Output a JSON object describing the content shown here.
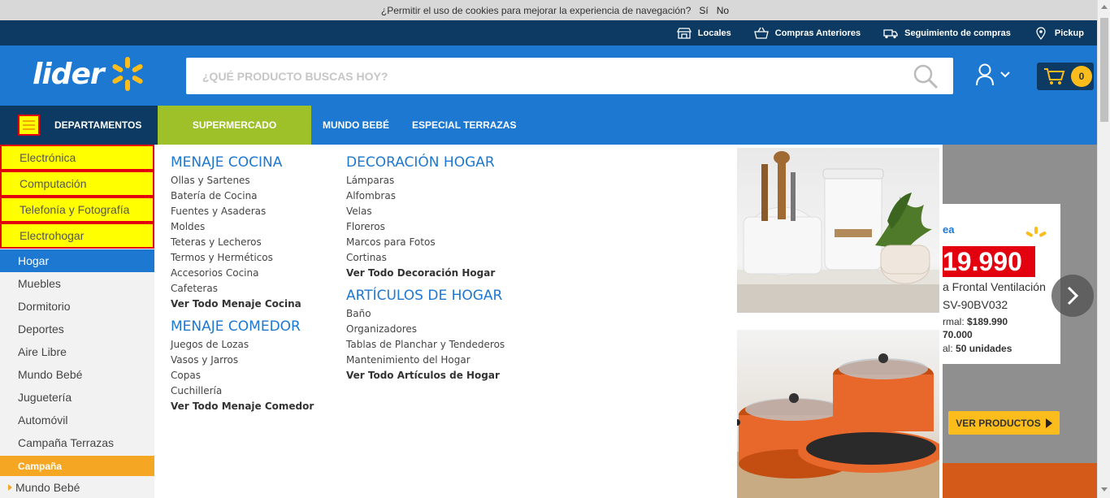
{
  "cookie_bar": {
    "message": "¿Permitir el uso de cookies para mejorar la experiencia de navegación?",
    "accept_label": "Sí",
    "decline_label": "No"
  },
  "utility_bar": {
    "items": [
      {
        "label": "Locales",
        "icon": "store-icon"
      },
      {
        "label": "Compras Anteriores",
        "icon": "basket-icon"
      },
      {
        "label": "Seguimiento de compras",
        "icon": "truck-icon"
      },
      {
        "label": "Pickup",
        "icon": "pin-icon"
      }
    ]
  },
  "header": {
    "logo_text": "lider",
    "search_placeholder": "¿QUÉ PRODUCTO BUSCAS HOY?",
    "cart_count": "0"
  },
  "nav": {
    "departments_label": "DEPARTAMENTOS",
    "supermarket_label": "SUPERMERCADO",
    "links": [
      "MUNDO BEBÉ",
      "ESPECIAL TERRAZAS"
    ]
  },
  "sidebar": {
    "highlighted": [
      "Electrónica",
      "Computación",
      "Telefonía y Fotografía",
      "Electrohogar"
    ],
    "active": "Hogar",
    "items": [
      "Muebles",
      "Dormitorio",
      "Deportes",
      "Aire Libre",
      "Mundo Bebé",
      "Juguetería",
      "Automóvil",
      "Campaña Terrazas"
    ],
    "campaign_label": "Campaña",
    "campaign_items": [
      "Mundo Bebé"
    ]
  },
  "menu": {
    "col1": {
      "sec1": {
        "title": "MENAJE COCINA",
        "links": [
          "Ollas y Sartenes",
          "Batería de Cocina",
          "Fuentes y Asaderas",
          "Moldes",
          "Teteras y Lecheros",
          "Termos y Herméticos",
          "Accesorios Cocina",
          "Cafeteras"
        ],
        "all": "Ver Todo Menaje Cocina"
      },
      "sec2": {
        "title": "MENAJE COMEDOR",
        "links": [
          "Juegos de Lozas",
          "Vasos y Jarros",
          "Copas",
          "Cuchillería"
        ],
        "all": "Ver Todo Menaje Comedor"
      }
    },
    "col2": {
      "sec1": {
        "title": "DECORACIÓN HOGAR",
        "links": [
          "Lámparas",
          "Alfombras",
          "Velas",
          "Floreros",
          "Marcos para Fotos",
          "Cortinas"
        ],
        "all": "Ver Todo Decoración Hogar"
      },
      "sec2": {
        "title": "ARTÍCULOS DE HOGAR",
        "links": [
          "Baño",
          "Organizadores",
          "Tablas de Planchar y Tendederos",
          "Mantenimiento del Hogar"
        ],
        "all": "Ver Todo Artículos de Hogar"
      }
    }
  },
  "banner": {
    "brand_fragment": "ea",
    "price": "19.990",
    "product_line1": "a Frontal Ventilación",
    "product_line2": "SV-90BV032",
    "normal_label": "rmal:",
    "normal_price": "$189.990",
    "second_price": "70.000",
    "stock_label": "al:",
    "stock_value": "50 unidades",
    "button_label": "VER PRODUCTOS"
  },
  "colors": {
    "brand_blue": "#1d78d1",
    "dark_blue": "#0d3a63",
    "green": "#9ec028",
    "yellow": "#fcbc1b",
    "highlight_yellow": "#ffff00",
    "highlight_border": "#e3000f",
    "orange": "#f5a623"
  }
}
